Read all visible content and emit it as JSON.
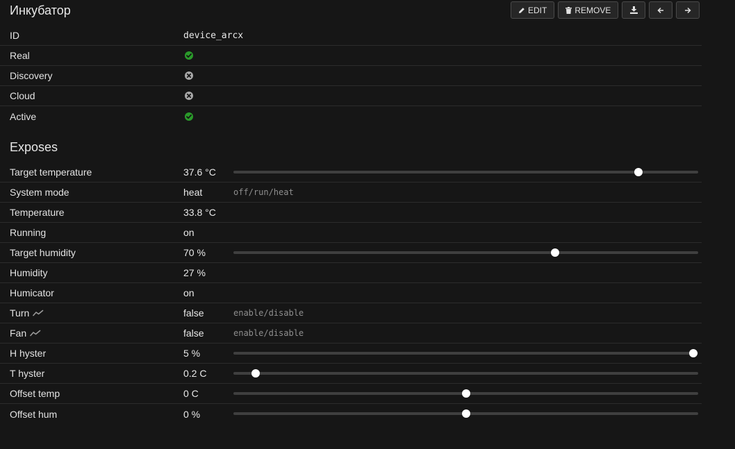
{
  "device": {
    "title": "Инкубатор"
  },
  "toolbar": {
    "edit_label": "EDIT",
    "remove_label": "REMOVE"
  },
  "properties": [
    {
      "name": "id",
      "label": "ID",
      "value": "device_arcx"
    },
    {
      "name": "real",
      "label": "Real",
      "status": true
    },
    {
      "name": "discovery",
      "label": "Discovery",
      "status": false
    },
    {
      "name": "cloud",
      "label": "Cloud",
      "status": false
    },
    {
      "name": "active",
      "label": "Active",
      "status": true
    }
  ],
  "status_colors": {
    "ok": "#2a9a2a",
    "off": "#a8a8a8"
  },
  "exposes_title": "Exposes",
  "exposes": [
    {
      "label": "Target temperature",
      "value": "37.6 °C",
      "slider": 0.872
    },
    {
      "label": "System mode",
      "value": "heat",
      "hint": "off/run/heat"
    },
    {
      "label": "Temperature",
      "value": "33.8 °C"
    },
    {
      "label": "Running",
      "value": "on"
    },
    {
      "label": "Target humidity",
      "value": "70 %",
      "slider": 0.692
    },
    {
      "label": "Humidity",
      "value": "27 %"
    },
    {
      "label": "Humicator",
      "value": "on"
    },
    {
      "label": "Turn",
      "trend": true,
      "value": "false",
      "hint": "enable/disable"
    },
    {
      "label": "Fan",
      "trend": true,
      "value": "false",
      "hint": "enable/disable"
    },
    {
      "label": "H hyster",
      "value": "5 %",
      "slider": 0.99
    },
    {
      "label": "T hyster",
      "value": "0.2 C",
      "slider": 0.048
    },
    {
      "label": "Offset temp",
      "value": "0 C",
      "slider": 0.5
    },
    {
      "label": "Offset hum",
      "value": "0 %",
      "slider": 0.5
    }
  ]
}
